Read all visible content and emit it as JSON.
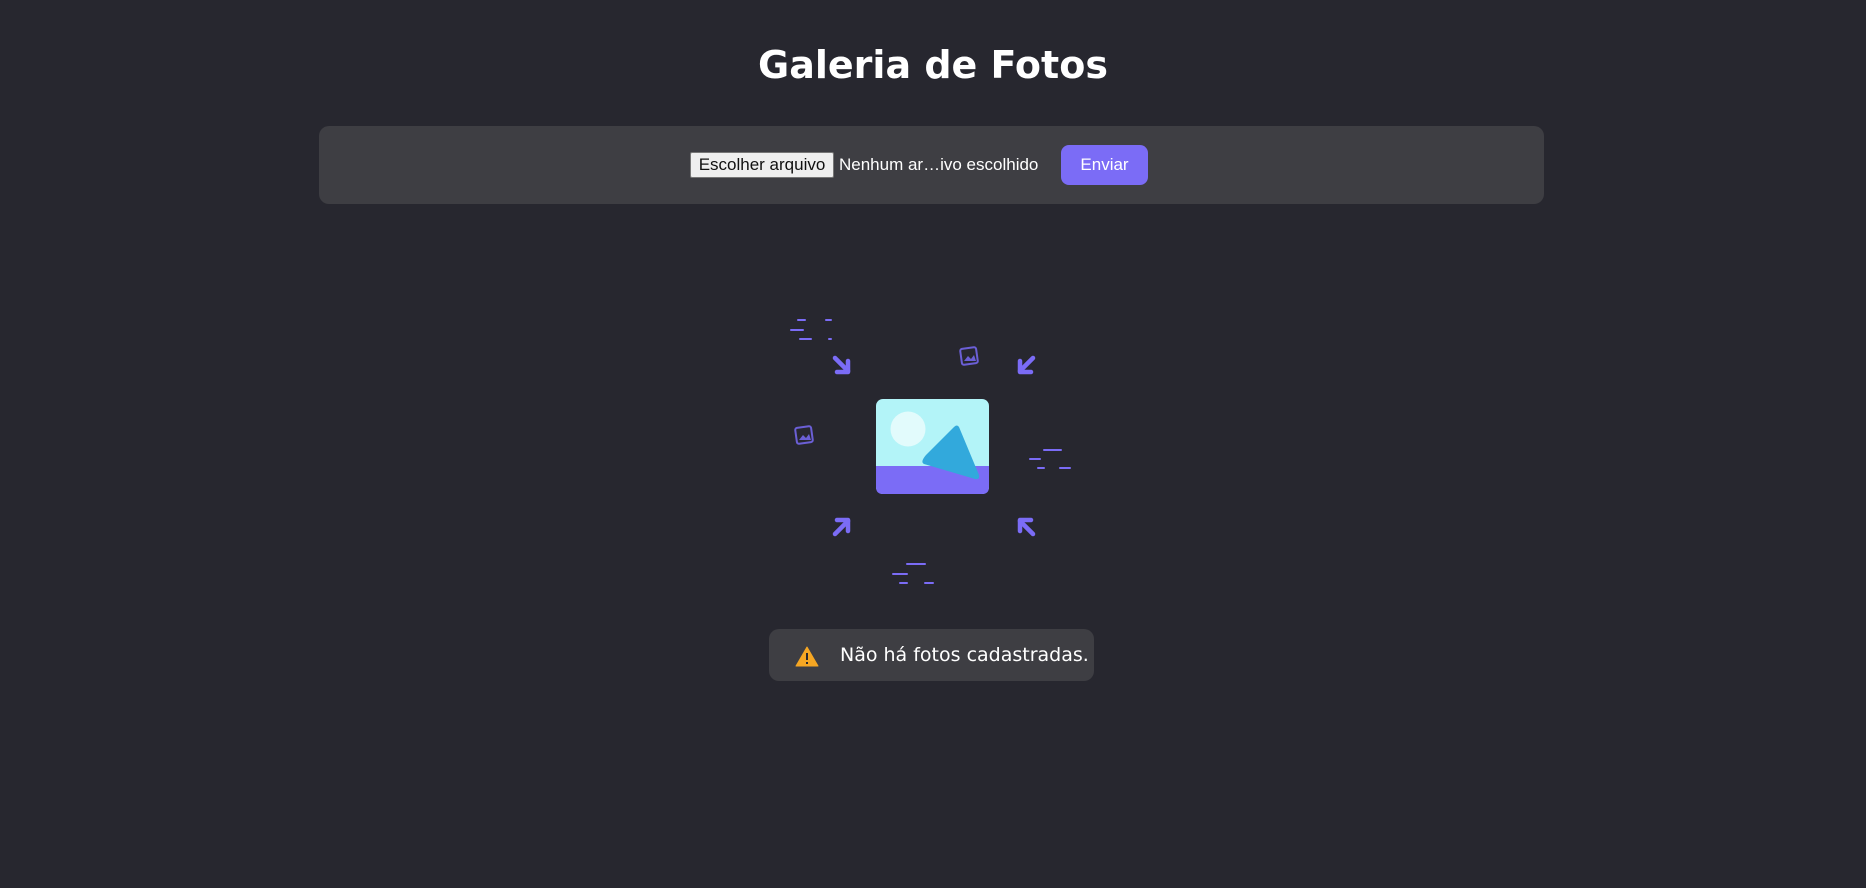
{
  "header": {
    "title": "Galeria de Fotos"
  },
  "upload_form": {
    "file_button_label": "Escolher arquivo",
    "file_status": "Nenhum ar…ivo escolhido",
    "submit_label": "Enviar"
  },
  "empty_state": {
    "illustration_icon": "image-gallery-illustration",
    "alert_icon": "warning-icon",
    "message": "Não há fotos cadastradas."
  },
  "colors": {
    "background": "#27272f",
    "panel": "#3e3e43",
    "accent": "#7b6cf6",
    "warning": "#f5a623"
  }
}
